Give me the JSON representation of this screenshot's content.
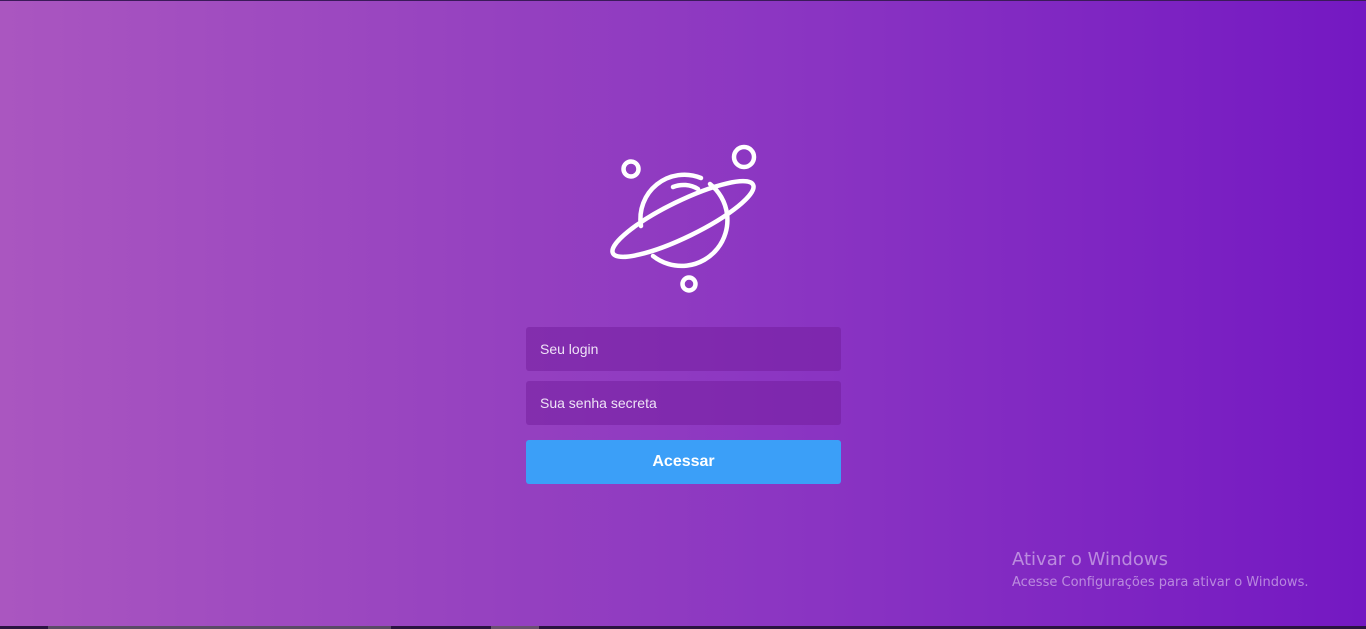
{
  "form": {
    "login_placeholder": "Seu login",
    "password_placeholder": "Sua senha secreta",
    "submit_label": "Acessar"
  },
  "watermark": {
    "title": "Ativar o Windows",
    "subtitle": "Acesse Configurações para ativar o Windows."
  },
  "icons": {
    "logo": "planet-icon"
  },
  "colors": {
    "background_start": "#aa56c0",
    "background_end": "#7418c2",
    "button": "#3b9ff8",
    "field_background": "#7b2fa8",
    "icon_stroke": "#ffffff"
  }
}
